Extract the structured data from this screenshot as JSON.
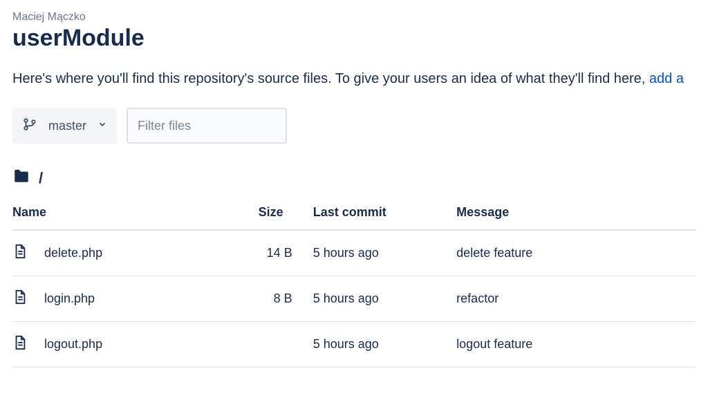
{
  "owner": "Maciej Mączko",
  "repo_name": "userModule",
  "description_text": "Here's where you'll find this repository's source files. To give your users an idea of what they'll find here, ",
  "description_link": "add a",
  "branch": {
    "current": "master"
  },
  "filter": {
    "placeholder": "Filter files"
  },
  "breadcrumb": {
    "path": "/"
  },
  "table": {
    "headers": {
      "name": "Name",
      "size": "Size",
      "last_commit": "Last commit",
      "message": "Message"
    },
    "rows": [
      {
        "name": "delete.php",
        "size": "14 B",
        "last_commit": "5 hours ago",
        "message": "delete feature"
      },
      {
        "name": "login.php",
        "size": "8 B",
        "last_commit": "5 hours ago",
        "message": "refactor"
      },
      {
        "name": "logout.php",
        "size": "",
        "last_commit": "5 hours ago",
        "message": "logout feature"
      }
    ]
  }
}
